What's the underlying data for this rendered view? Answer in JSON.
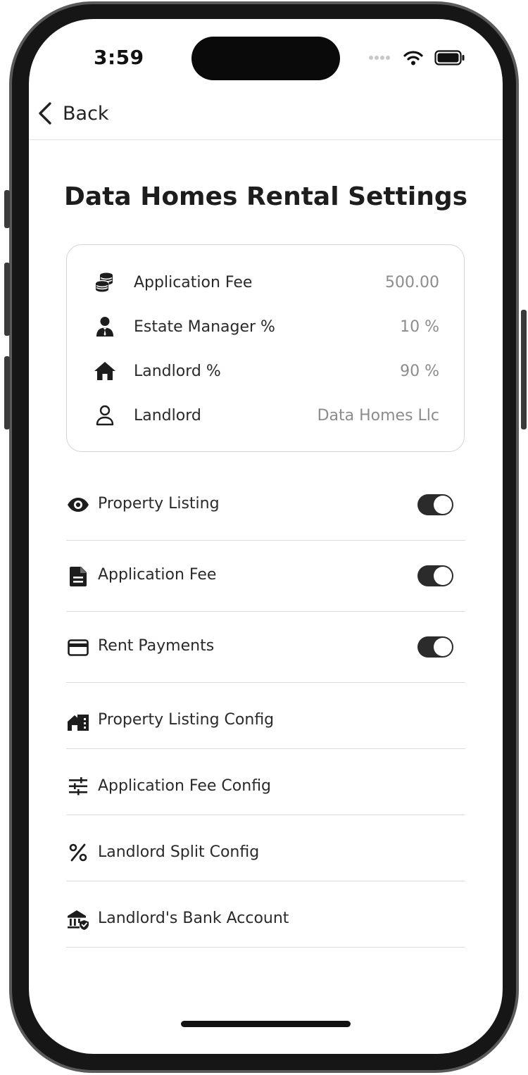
{
  "status_bar": {
    "time": "3:59"
  },
  "nav": {
    "back_label": "Back"
  },
  "page": {
    "title": "Data Homes Rental Settings"
  },
  "summary": [
    {
      "icon": "coins-icon",
      "label": "Application Fee",
      "value": "500.00"
    },
    {
      "icon": "estate-manager-icon",
      "label": "Estate Manager %",
      "value": "10 %"
    },
    {
      "icon": "house-icon",
      "label": "Landlord %",
      "value": "90 %"
    },
    {
      "icon": "user-outline-icon",
      "label": "Landlord",
      "value": "Data Homes Llc"
    }
  ],
  "toggles": [
    {
      "icon": "eye-icon",
      "label": "Property Listing",
      "on": true
    },
    {
      "icon": "document-icon",
      "label": "Application Fee",
      "on": true
    },
    {
      "icon": "credit-card-icon",
      "label": "Rent Payments",
      "on": true
    }
  ],
  "config_links": [
    {
      "icon": "property-config-icon",
      "label": "Property Listing Config"
    },
    {
      "icon": "sliders-icon",
      "label": "Application Fee Config"
    },
    {
      "icon": "percent-icon",
      "label": "Landlord Split Config"
    },
    {
      "icon": "bank-icon",
      "label": "Landlord's Bank Account"
    }
  ],
  "colors": {
    "toggle_on": "#2b2b2b",
    "divider": "#dcdcdc",
    "value_text": "#8c8c8c"
  }
}
